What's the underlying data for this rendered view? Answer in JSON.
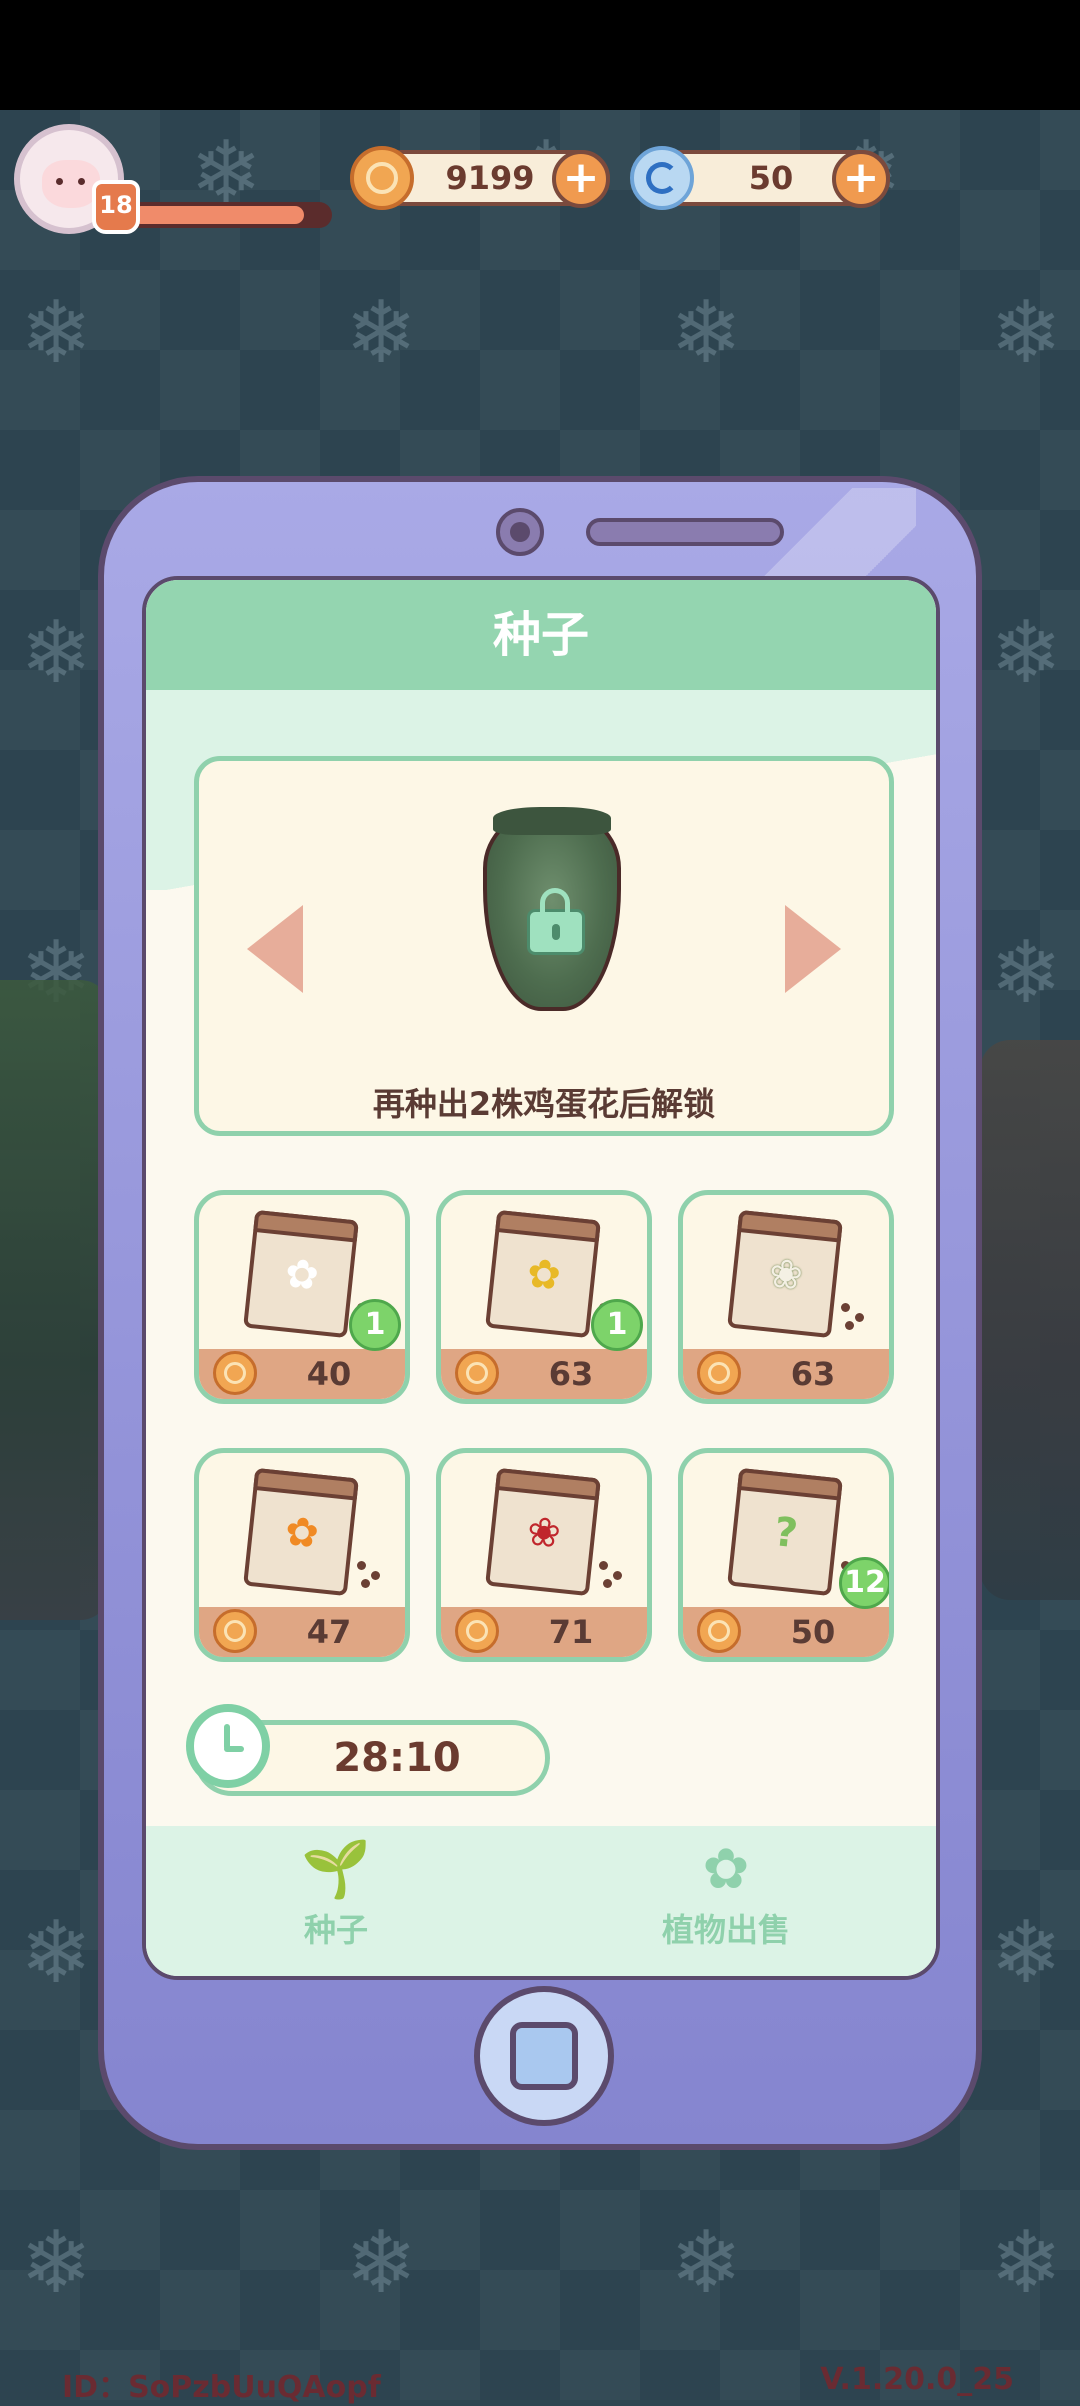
{
  "hud": {
    "level": "18",
    "coins": "9199",
    "gems": "50",
    "xp_fraction": 0.88,
    "coin_icon": "coin-icon",
    "gem_icon": "spiral-gem-icon"
  },
  "phone": {
    "title": "种子",
    "featured": {
      "unlock_text": "再种出2株鸡蛋花后解锁",
      "icon": "locked-vase-icon"
    },
    "seeds": [
      {
        "price": "40",
        "count": "1",
        "art": "cotton-flower"
      },
      {
        "price": "63",
        "count": "1",
        "art": "yellow-lily"
      },
      {
        "price": "63",
        "count": "",
        "art": "white-flowers"
      },
      {
        "price": "47",
        "count": "",
        "art": "orange-flower"
      },
      {
        "price": "71",
        "count": "",
        "art": "red-rose"
      },
      {
        "price": "50",
        "count": "12",
        "art": "mystery-question"
      }
    ],
    "timer": "28:10",
    "nav": [
      {
        "label": "种子",
        "icon": "sprout-icon"
      },
      {
        "label": "植物出售",
        "icon": "flower-gift-icon"
      }
    ]
  },
  "footer": {
    "id": "ID：SoPzbUuQAopf",
    "version": "V.1.20.0_25"
  },
  "colors": {
    "accent_green": "#8fd1ac",
    "phone_purple": "#9292d8",
    "coin_orange": "#f1a652"
  }
}
